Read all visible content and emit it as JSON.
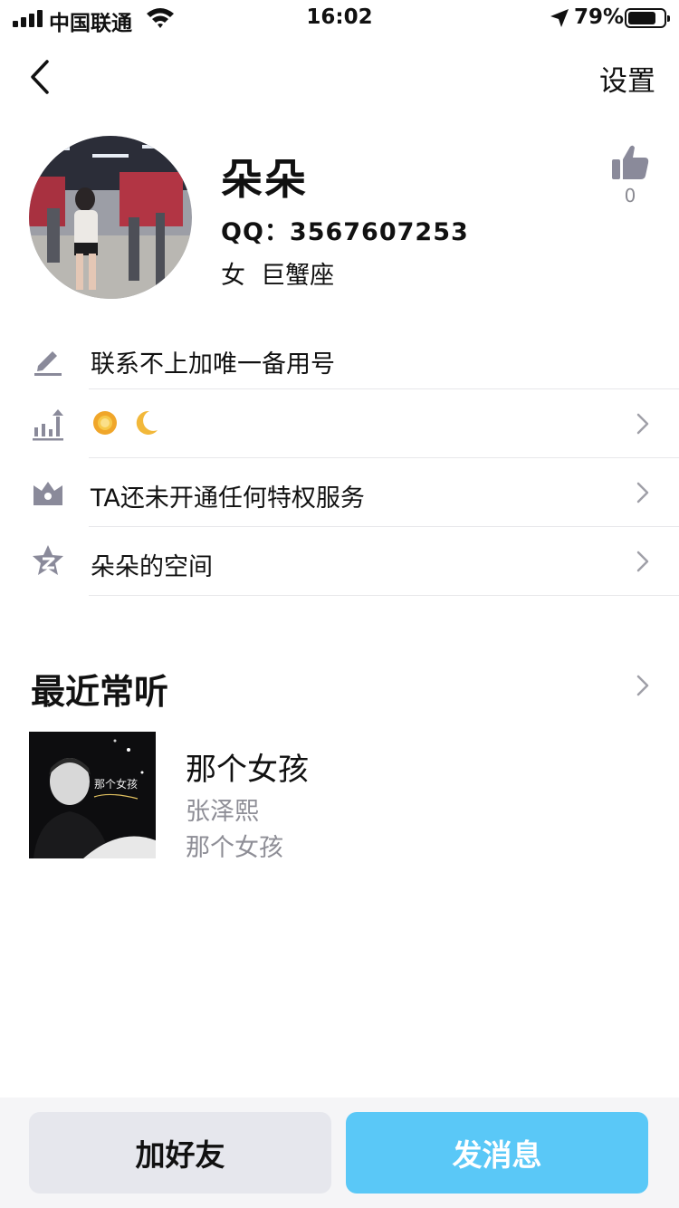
{
  "status_bar": {
    "carrier": "中国联通",
    "time": "16:02",
    "battery_percent_label": "79%",
    "battery_level": 0.79
  },
  "nav": {
    "back_icon": "chevron-left-icon",
    "settings_label": "设置"
  },
  "profile": {
    "nickname": "朵朵",
    "qq_label": "QQ：3567607253",
    "gender_zodiac": "女  巨蟹座",
    "like_icon": "thumbs-up-icon",
    "like_count": "0"
  },
  "info_rows": [
    {
      "icon": "pencil-icon",
      "text": "联系不上加唯一备用号",
      "has_chevron": false
    },
    {
      "icon": "level-chart-icon",
      "text": "",
      "badges": [
        "sun-emoji",
        "moon-emoji"
      ],
      "has_chevron": true
    },
    {
      "icon": "crown-icon",
      "text": "TA还未开通任何特权服务",
      "has_chevron": true
    },
    {
      "icon": "qzone-star-icon",
      "text": "朵朵的空间",
      "has_chevron": true
    }
  ],
  "recent": {
    "title": "最近常听",
    "song": {
      "title": "那个女孩",
      "artist": "张泽熙",
      "album": "那个女孩",
      "cover_text": "那个女孩"
    }
  },
  "bottom": {
    "add_friend_label": "加好友",
    "send_message_label": "发消息"
  },
  "colors": {
    "accent_blue": "#5ac8f7",
    "icon_gray": "#8a8a9a",
    "divider": "#e7e7ea"
  }
}
